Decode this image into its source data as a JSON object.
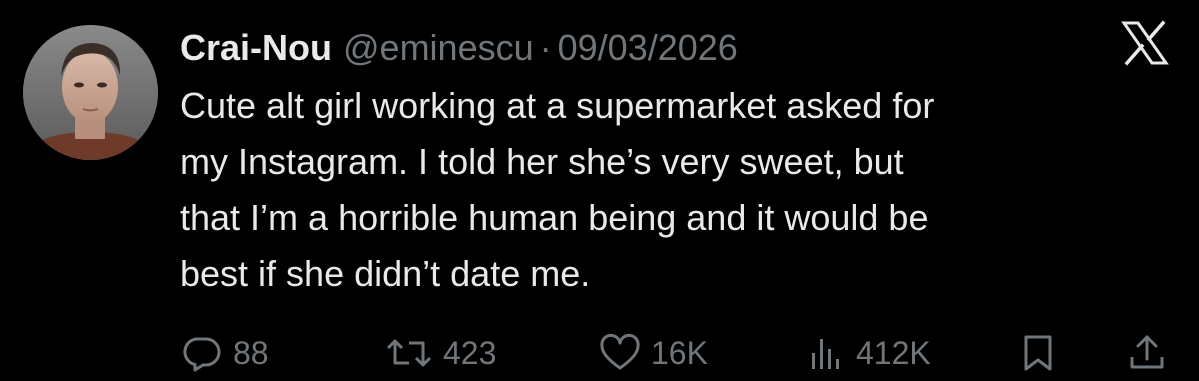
{
  "author": {
    "display_name": "Crai-Nou",
    "handle": "@eminescu",
    "separator": "·",
    "date": "09/03/2026"
  },
  "logo_icon": "x-logo-icon",
  "body": {
    "lines": [
      "Cute alt girl working at a supermarket asked for",
      "my Instagram. I told her she’s very sweet, but",
      "that I’m a horrible human being and it would be",
      "best if she didn’t date me."
    ]
  },
  "actions": {
    "replies": "88",
    "reposts": "423",
    "likes": "16K",
    "views": "412K"
  },
  "icons": {
    "reply": "reply-icon",
    "repost": "repost-icon",
    "like": "heart-icon",
    "views": "views-icon",
    "bookmark": "bookmark-icon",
    "share": "share-icon"
  },
  "colors": {
    "background": "#000000",
    "text": "#e7e9ea",
    "secondary": "#71767b"
  }
}
